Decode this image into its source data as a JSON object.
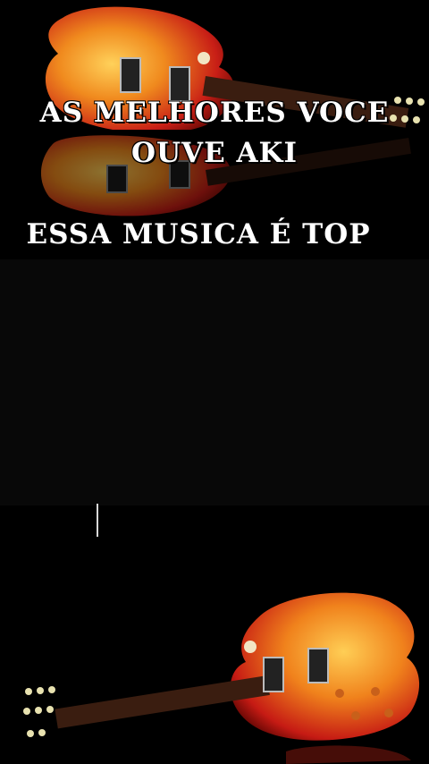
{
  "overlay": {
    "line1": "AS MELHORES VOCE",
    "line2": "OUVE AKI",
    "line3": "ESSA MUSICA É TOP"
  },
  "colors": {
    "background": "#000000",
    "guitar_body_red": "#d6241a",
    "guitar_body_orange": "#f4a020",
    "fretboard": "#3a1d10"
  },
  "icons": {
    "top_image": "electric-guitar-icon",
    "bottom_image": "electric-guitar-icon"
  }
}
